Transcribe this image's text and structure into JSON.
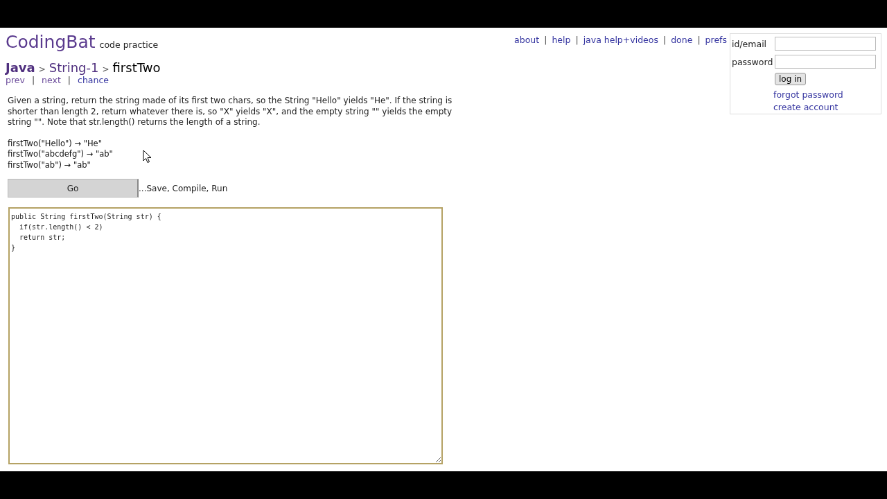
{
  "header": {
    "logo": "CodingBat",
    "tagline": "code practice"
  },
  "top_links": [
    "about",
    "help",
    "java help+videos",
    "done",
    "prefs"
  ],
  "breadcrumb": [
    "Java",
    "String-1",
    "firstTwo"
  ],
  "breadcrumb_separator": ">",
  "nav_links": [
    "prev",
    "next",
    "chance"
  ],
  "link_separator": "|",
  "description": "Given a string, return the string made of its first two chars, so the String \"Hello\" yields \"He\". If the string is shorter than length 2, return whatever there is, so \"X\" yields \"X\", and the empty string \"\" yields the empty string \"\". Note that str.length() returns the length of a string.",
  "examples": [
    "firstTwo(\"Hello\") → \"He\"",
    "firstTwo(\"abcdefg\") → \"ab\"",
    "firstTwo(\"ab\") → \"ab\""
  ],
  "go_button": "Go",
  "go_hint": "...Save, Compile, Run",
  "code_lines": [
    "public String firstTwo(String str) {",
    "  if(str.length() < 2)",
    "  return str;",
    "}"
  ],
  "login": {
    "id_label": "id/email",
    "password_label": "password",
    "button": "log in",
    "forgot": "forgot password",
    "create": "create account"
  }
}
